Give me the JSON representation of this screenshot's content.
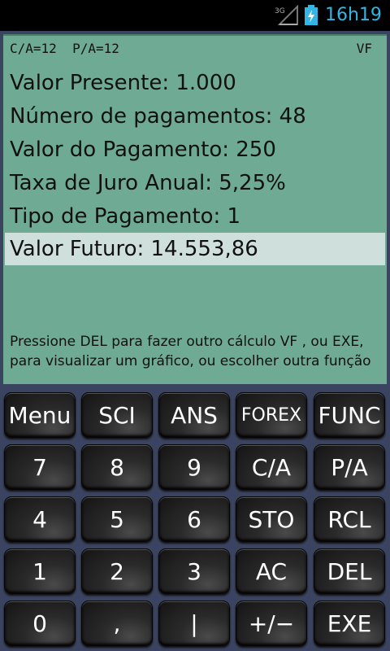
{
  "status_bar": {
    "network": "3G",
    "time": "16h19"
  },
  "display": {
    "mode_left": "C/A=12  P/A=12",
    "mode_right": "VF",
    "rows": [
      {
        "label": "Valor Presente: 1.000"
      },
      {
        "label": "Número de pagamentos: 48"
      },
      {
        "label": "Valor do Pagamento: 250"
      },
      {
        "label": "Taxa de Juro Anual: 5,25%"
      },
      {
        "label": "Tipo de Pagamento: 1"
      },
      {
        "label": "Valor Futuro: 14.553,86"
      }
    ],
    "message": "Pressione DEL para fazer outro cálculo VF , ou EXE, para visualizar um gráfico, ou escolher outra função"
  },
  "keypad": {
    "rows": [
      [
        "Menu",
        "SCI",
        "ANS",
        "FOREX",
        "FUNC"
      ],
      [
        "7",
        "8",
        "9",
        "C/A",
        "P/A"
      ],
      [
        "4",
        "5",
        "6",
        "STO",
        "RCL"
      ],
      [
        "1",
        "2",
        "3",
        "AC",
        "DEL"
      ],
      [
        "0",
        ",",
        "|",
        "+/−",
        "EXE"
      ]
    ]
  }
}
